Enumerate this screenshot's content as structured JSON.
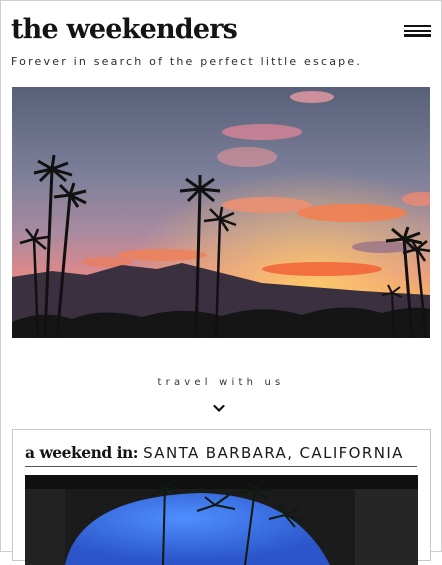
{
  "header": {
    "brand": "the weekenders",
    "tagline": "Forever in search of the perfect little escape."
  },
  "icons": {
    "menu": "hamburger-menu-icon",
    "scroll": "chevron-down-icon"
  },
  "cta": {
    "travel_label": "travel with us"
  },
  "feature_card": {
    "prefix": "a weekend in:",
    "place": "SANTA BARBARA, CALIFORNIA"
  },
  "colors": {
    "text": "#141414",
    "card_border": "#c8c8c8",
    "sunset_orange": "#f26a3c"
  }
}
